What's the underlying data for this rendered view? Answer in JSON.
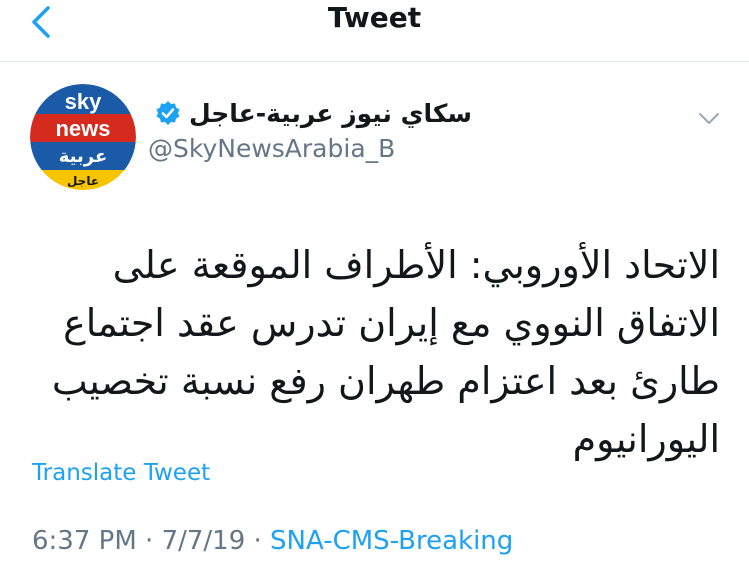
{
  "header": {
    "title": "Tweet"
  },
  "author": {
    "display_name": "سكاي نيوز عربية-عاجل",
    "handle": "@SkyNewsArabia_B",
    "avatar_text": {
      "line1": "sky",
      "line2": "news",
      "line3": "عربية",
      "line4": "عاجل"
    },
    "verified": true
  },
  "tweet": {
    "text": "الاتحاد الأوروبي: الأطراف الموقعة على الاتفاق النووي مع إيران تدرس عقد اجتماع طارئ بعد اعتزام طهران رفع نسبة تخصيب اليورانيوم"
  },
  "translate_label": "Translate Tweet",
  "meta": {
    "time": "6:37 PM",
    "separator": " · ",
    "date": "7/7/19",
    "source": "SNA-CMS-Breaking"
  },
  "icons": {
    "back": "chevron-left-icon",
    "verified": "verified-badge-icon",
    "more": "chevron-down-icon"
  },
  "colors": {
    "accent": "#1da1f2",
    "secondary_text": "#657786",
    "avatar_red": "#d52b1e",
    "avatar_blue": "#1a5aa6",
    "avatar_yellow": "#f7c500"
  }
}
